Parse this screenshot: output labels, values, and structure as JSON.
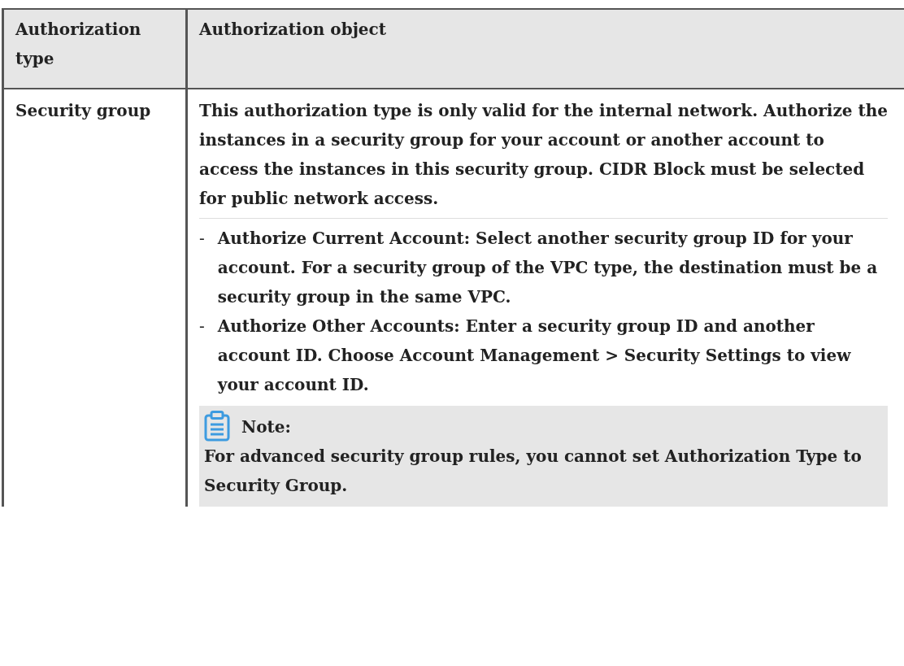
{
  "table": {
    "columns": [
      "Authorization type",
      "Authorization object"
    ],
    "rows": [
      {
        "type": "Security group",
        "description": "This authorization type is only valid for the internal network. Authorize the instances in a security group for your account or another account to access the instances in this security group. CIDR Block must be selected for public network access.",
        "bullets": [
          {
            "marker": "-",
            "text": "Authorize Current Account: Select another security group ID for your account. For a security group of the VPC type, the destination must be a security group in the same VPC."
          },
          {
            "marker": "-",
            "text": "Authorize Other Accounts: Enter a security group ID and another account ID. Choose Account Management > Security Settings to view your account ID."
          }
        ],
        "note": {
          "title": "Note:",
          "text": "For advanced security group rules, you cannot set Authorization Type to Security Group."
        }
      }
    ]
  }
}
